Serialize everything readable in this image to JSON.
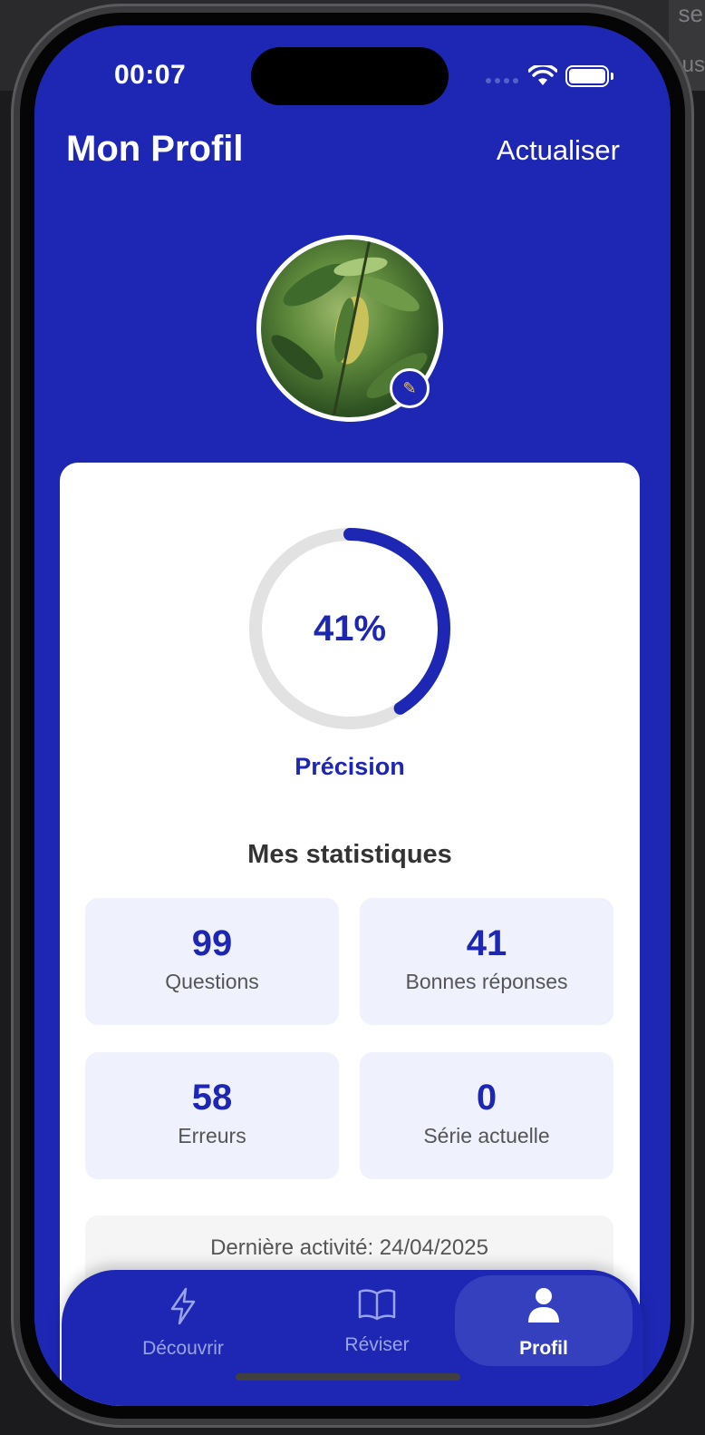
{
  "desktop": {
    "corner_top": "se",
    "corner_mid": "us"
  },
  "status_bar": {
    "time": "00:07"
  },
  "header": {
    "title": "Mon Profil",
    "refresh_label": "Actualiser"
  },
  "profile": {
    "avatar": "plant-leaves-photo",
    "edit_icon": "pencil-icon"
  },
  "accuracy": {
    "value_text": "41%",
    "value": 41,
    "label": "Précision"
  },
  "stats": {
    "title": "Mes statistiques",
    "items": [
      {
        "value": "99",
        "label": "Questions"
      },
      {
        "value": "41",
        "label": "Bonnes réponses"
      },
      {
        "value": "58",
        "label": "Erreurs"
      },
      {
        "value": "0",
        "label": "Série actuelle"
      }
    ]
  },
  "last_activity": {
    "text": "Dernière activité: 24/04/2025"
  },
  "tabs": [
    {
      "label": "Découvrir",
      "icon": "lightning-icon",
      "active": false
    },
    {
      "label": "Réviser",
      "icon": "book-icon",
      "active": false
    },
    {
      "label": "Profil",
      "icon": "person-icon",
      "active": true
    }
  ],
  "colors": {
    "primary": "#1d27b4",
    "ring_track": "#e2e2e2",
    "stat_bg": "#eff2fd"
  }
}
